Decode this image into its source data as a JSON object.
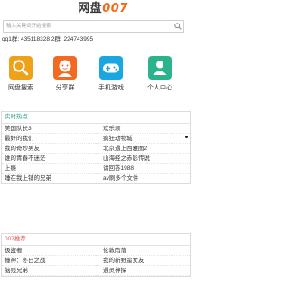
{
  "header": {
    "logo_cn": "网盘",
    "logo_num": "007"
  },
  "search": {
    "placeholder": "输入关键词开始搜索"
  },
  "qq_line": "qq1群: 435118328 2群: 224743995",
  "quick_links": [
    {
      "label": "网盘搜索",
      "icon": "search-icon",
      "color": "#f0a11a"
    },
    {
      "label": "分享群",
      "icon": "user-icon",
      "color": "#f26a22"
    },
    {
      "label": "手机游戏",
      "icon": "gamepad-icon",
      "color": "#1aa6e0"
    },
    {
      "label": "个人中心",
      "icon": "person-icon",
      "color": "#2bb48c"
    }
  ],
  "hot": {
    "title": "实时热点",
    "items": [
      "美国队长3",
      "欢乐颂",
      "最好的我们",
      "疯狂动物城",
      "我的奇妙男友",
      "北京遇上西雅图2",
      "谁的青春不迷茫",
      "山海经之赤影传说",
      "上瘾",
      "请回答1988",
      "睡在我上铺的兄弟",
      "av刷多个文件"
    ]
  },
  "recommend": {
    "title": "007推荐",
    "items": [
      "极盗者",
      "伦敦陷落",
      "撞神：冬日之战",
      "我的新野蛮女友",
      "脑残兄弟",
      "通灵神探"
    ]
  }
}
